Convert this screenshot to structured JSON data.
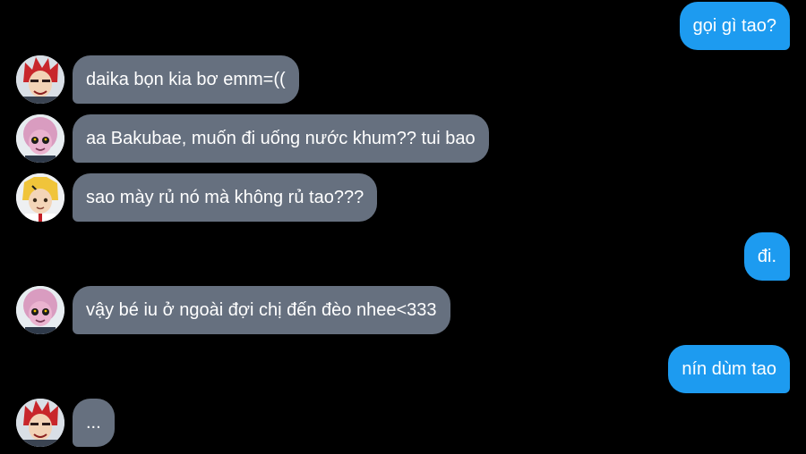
{
  "messages": [
    {
      "from": "me",
      "text": "gọi gì tao?"
    },
    {
      "from": "kirishima",
      "text": "daika bọn kia bơ emm=(("
    },
    {
      "from": "ashido",
      "text": "aa Bakubae, muốn đi uống nước khum?? tui bao"
    },
    {
      "from": "kaminari",
      "text": "sao mày rủ nó mà không rủ tao???"
    },
    {
      "from": "me",
      "text": "đi."
    },
    {
      "from": "ashido",
      "text": "vậy bé iu ở ngoài đợi chị đến đèo nhee<333"
    },
    {
      "from": "me",
      "text": "nín dùm tao"
    },
    {
      "from": "kirishima",
      "text": "..."
    }
  ],
  "colors": {
    "background": "#000000",
    "incoming_bubble": "#66707f",
    "outgoing_bubble": "#1d9bf0",
    "text": "#ffffff"
  }
}
